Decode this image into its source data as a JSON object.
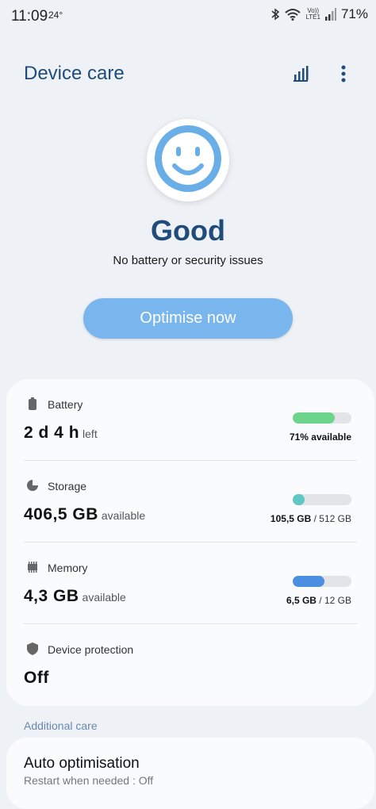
{
  "status_bar": {
    "time": "11:09",
    "temperature": "24°",
    "volte_line1": "Vo))",
    "volte_line2": "LTE1",
    "battery_percent": "71%"
  },
  "header": {
    "title": "Device care",
    "icons": [
      "stats-icon",
      "more-options-icon"
    ]
  },
  "summary": {
    "status": "Good",
    "subtitle": "No battery or security issues",
    "optimise_label": "Optimise now",
    "face_icon": "smiley-face-icon"
  },
  "items": {
    "battery": {
      "label": "Battery",
      "value": "2 d 4 h",
      "unit": "left",
      "caption_bold": "71% available",
      "caption_rest": "",
      "fill_fraction": 0.71,
      "color": "#6dd48c"
    },
    "storage": {
      "label": "Storage",
      "value": "406,5 GB",
      "unit": "available",
      "caption_bold": "105,5 GB",
      "caption_rest": " / 512 GB",
      "fill_fraction": 0.206,
      "color": "#5ec6c4"
    },
    "memory": {
      "label": "Memory",
      "value": "4,3 GB",
      "unit": "available",
      "caption_bold": "6,5 GB",
      "caption_rest": " / 12 GB",
      "fill_fraction": 0.54,
      "color": "#4a8fe0"
    },
    "protection": {
      "label": "Device protection",
      "value": "Off"
    }
  },
  "additional": {
    "section_title": "Additional care",
    "auto_title": "Auto optimisation",
    "auto_sub": "Restart when needed : Off"
  },
  "colors": {
    "accent": "#1f4c7a",
    "button": "#7ab6ee",
    "face": "#6aaee8"
  }
}
